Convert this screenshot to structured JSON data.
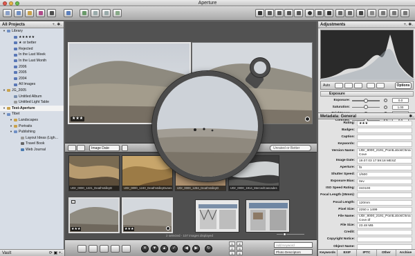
{
  "window": {
    "title": "Aperture"
  },
  "left_panel": {
    "header": "All Projects",
    "header_controls": "+. ✱.",
    "items": [
      {
        "label": "Library",
        "kind": "folder"
      },
      {
        "label": "★★★★★",
        "kind": "smart"
      },
      {
        "label": "★ or better",
        "kind": "smart"
      },
      {
        "label": "Rejected",
        "kind": "smart"
      },
      {
        "label": "In the Last Week",
        "kind": "smart"
      },
      {
        "label": "In the Last Month",
        "kind": "smart"
      },
      {
        "label": "2006",
        "kind": "smart"
      },
      {
        "label": "2005",
        "kind": "smart"
      },
      {
        "label": "2004",
        "kind": "smart"
      },
      {
        "label": "All Images",
        "kind": "smart"
      },
      {
        "label": "JG_2005",
        "kind": "project"
      },
      {
        "label": "Untitled Album",
        "kind": "album"
      },
      {
        "label": "Untitled Light Table",
        "kind": "lighttable"
      },
      {
        "label": "Test-Aperture",
        "kind": "project"
      },
      {
        "label": "Tibet",
        "kind": "folder"
      },
      {
        "label": "Landscapes",
        "kind": "project"
      },
      {
        "label": "Portraits",
        "kind": "project"
      },
      {
        "label": "Publishing",
        "kind": "folder"
      },
      {
        "label": "Layout Ideas (Ligh...",
        "kind": "lighttable"
      },
      {
        "label": "Travel Book",
        "kind": "book"
      },
      {
        "label": "Web Journal",
        "kind": "web"
      }
    ],
    "vault_label": "Vault"
  },
  "viewer": {
    "left_rating": "★★★"
  },
  "browser": {
    "sort_label": "Image Date",
    "rating_filter": "Unrated or Better",
    "thumbs": [
      {
        "caption": "IJDr_0000_1221_DeathValleyD"
      },
      {
        "caption": "IJDr_0000_1240_DeathValleyDunes"
      },
      {
        "caption": "IJDr_0000_1284_DeathValleyD"
      },
      {
        "caption": "IJDr_0000_1914_MercedCascades"
      },
      {
        "caption": "",
        "rating": "★★★"
      },
      {
        "caption": "",
        "rating": "★★★"
      },
      {
        "caption": ""
      },
      {
        "caption": ""
      }
    ],
    "status": "2 selected - 107 images displayed"
  },
  "bottom_bar": {
    "keyword_placeholder": "Add Keyword",
    "keyword_set": "Photo Descriptors",
    "key_labels": [
      "1",
      "2",
      "3",
      "4",
      "5",
      "6"
    ]
  },
  "adjustments": {
    "header": "Adjustments",
    "auto_label": "Auto",
    "options_label": "Options",
    "exposure_section": "Exposure",
    "sliders": [
      {
        "label": "Exposure:",
        "value": "0.0",
        "level": 0.5
      },
      {
        "label": "Saturation:",
        "value": "1.00",
        "level": 0.5
      },
      {
        "label": "Brightness:",
        "value": "0.0",
        "level": 0.5
      },
      {
        "label": "Contrast:",
        "value": "0.0",
        "level": 0.5
      }
    ]
  },
  "metadata": {
    "header": "Metadata: General",
    "rows": [
      {
        "key": "Rating:",
        "value": "★★★"
      },
      {
        "key": "Badges:",
        "value": ""
      },
      {
        "key": "Caption:",
        "value": ""
      },
      {
        "key": "Keywords:",
        "value": ""
      },
      {
        "key": "Version Name:",
        "value": "IJDr_8000_2191_PointLobosChina Cove"
      },
      {
        "key": "Image Date:",
        "value": "19.07.03 17:59:18 MESZ"
      },
      {
        "key": "Aperture:",
        "value": "f9"
      },
      {
        "key": "Shutter Speed:",
        "value": "1/500"
      },
      {
        "key": "Exposure Bias:",
        "value": "0ev"
      },
      {
        "key": "ISO Speed Rating:",
        "value": "ISO100"
      },
      {
        "key": "Focal Length (35mm):",
        "value": ""
      },
      {
        "key": "Focal Length:",
        "value": "120mm"
      },
      {
        "key": "Pixel Size:",
        "value": "2250 x 1499"
      },
      {
        "key": "File Name:",
        "value": "IJDr_8000_2191_PointLobosChina Cove.tif"
      },
      {
        "key": "File Size:",
        "value": "23.48 MB"
      },
      {
        "key": "Credit:",
        "value": ""
      },
      {
        "key": "Copyright Notice:",
        "value": ""
      },
      {
        "key": "Object Name:",
        "value": ""
      }
    ],
    "tabs": [
      "Keywords",
      "EXIF",
      "IPTC",
      "Other",
      "Archive"
    ]
  },
  "colors": {
    "selection": "#f3f3f3",
    "panel_bg": "#d7dde6",
    "dark_bg": "#505050"
  }
}
